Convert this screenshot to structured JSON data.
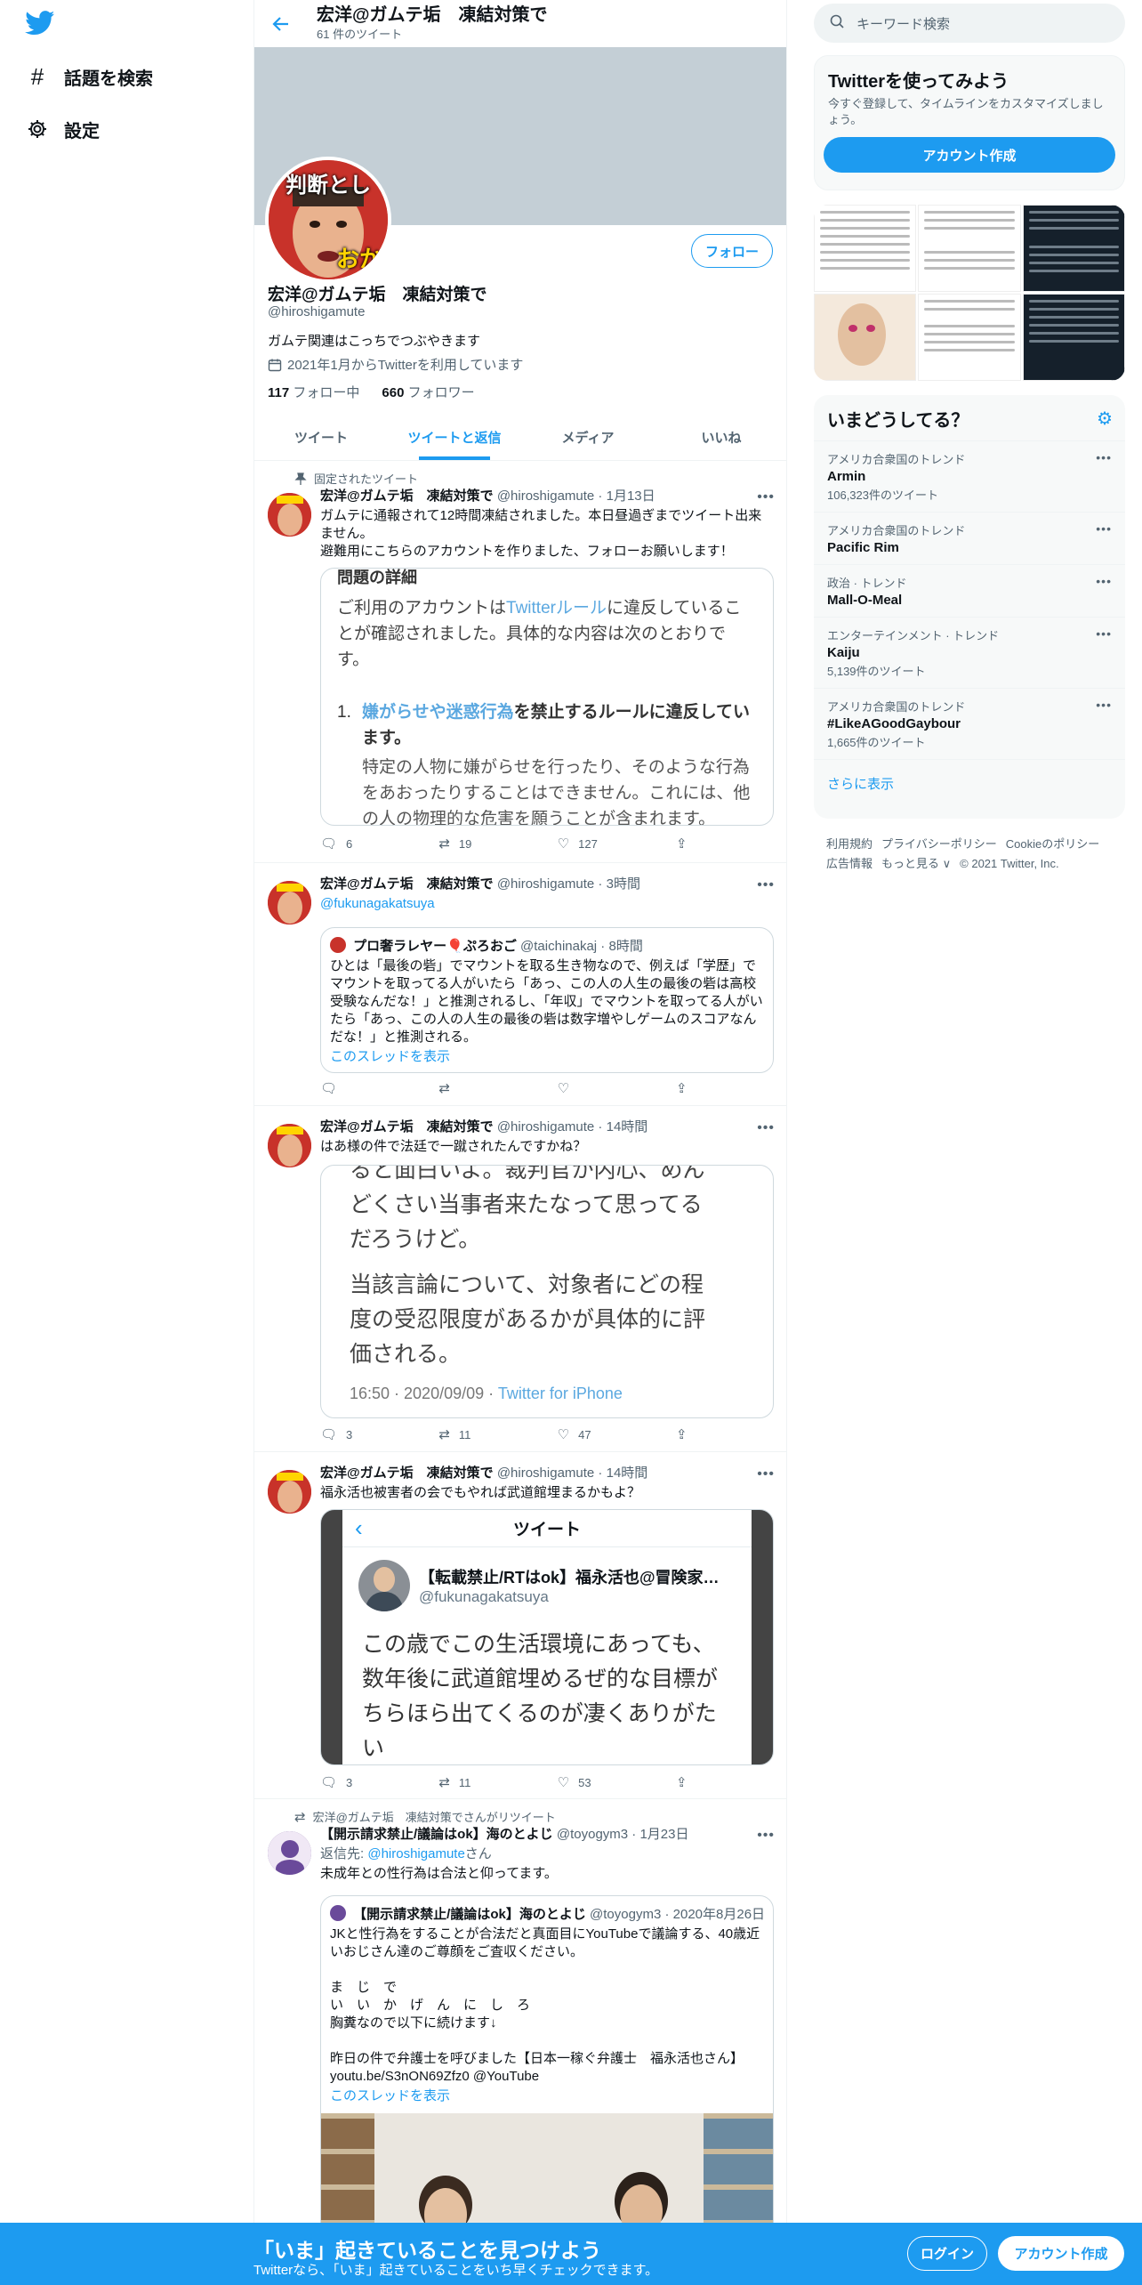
{
  "nav": {
    "explore_label": "話題を検索",
    "settings_label": "設定"
  },
  "header": {
    "title": "宏洋@ガムテ垢　凍結対策で",
    "subtitle": "61 件のツイート"
  },
  "profile": {
    "avatar_text_1": "判断とし",
    "avatar_text_2": "おか",
    "follow_label": "フォロー",
    "name": "宏洋@ガムテ垢　凍結対策で",
    "handle": "@hiroshigamute",
    "bio": "ガムテ関連はこっちでつぶやきます",
    "joined": "2021年1月からTwitterを利用しています",
    "following_count": "117",
    "following_label": "フォロー中",
    "followers_count": "660",
    "followers_label": "フォロワー"
  },
  "tabs": [
    "ツイート",
    "ツイートと返信",
    "メディア",
    "いいね"
  ],
  "tweets": [
    {
      "context": "固定されたツイート",
      "name": "宏洋@ガムテ垢　凍結対策で",
      "handle": "@hiroshigamute",
      "time": "1月13日",
      "text1": "ガムテに通報されて12時間凍結されました。本日昼過ぎまでツイート出来ません。",
      "text2": "避難用にこちらのアカウントを作りました、フォローお願いします！",
      "shot": {
        "heading": "問題の詳細",
        "p1_a": "ご利用のアカウントは",
        "p1_link": "Twitterルール",
        "p1_b": "に違反していることが確認されました。具体的な内容は次のとおりです。",
        "item_num": "1.",
        "item_link": "嫌がらせや迷惑行為",
        "item_b": "を禁止するルールに違反しています。",
        "item_desc": "特定の人物に嫌がらせを行ったり、そのような行為をあおったりすることはできません。これには、他の人の物理的な危害を願うことが含まれます。"
      },
      "replies": "6",
      "retweets": "19",
      "likes": "127"
    },
    {
      "name": "宏洋@ガムテ垢　凍結対策で",
      "handle": "@hiroshigamute",
      "time": "3時間",
      "text1": "@fukunagakatsuya",
      "quote": {
        "name": "プロ奢ラレヤー🎈ぷろおご",
        "handle": "@taichinakaj",
        "time": "8時間",
        "text": "ひとは「最後の砦」でマウントを取る生き物なので、例えば「学歴」でマウントを取ってる人がいたら「あっ、この人の人生の最後の砦は高校受験なんだな！」と推測されるし、「年収」でマウントを取ってる人がいたら「あっ、この人の人生の最後の砦は数字増やしゲームのスコアなんだな！」と推測される。",
        "thread_label": "このスレッドを表示"
      }
    },
    {
      "name": "宏洋@ガムテ垢　凍結対策で",
      "handle": "@hiroshigamute",
      "time": "14時間",
      "text1": "はあ様の件で法廷で一蹴されたんですかね？",
      "shot": {
        "l1": "ると面白いよ。裁判官か内心、めん",
        "l2": "どくさい当事者来たなって思ってる",
        "l3": "だろうけど。",
        "l4": "当該言論について、対象者にどの程",
        "l5": "度の受忍限度があるかが具体的に評",
        "l6": "価される。",
        "meta_time": "16:50 · 2020/09/09 · ",
        "meta_src": "Twitter for iPhone"
      },
      "replies": "3",
      "retweets": "11",
      "likes": "47"
    },
    {
      "name": "宏洋@ガムテ垢　凍結対策で",
      "handle": "@hiroshigamute",
      "time": "14時間",
      "text1": "福永活也被害者の会でもやれば武道館埋まるかもよ？",
      "shot": {
        "title": "ツイート",
        "name": "【転載禁止/RTはok】福永活也@冒険家…",
        "handle": "@fukunagakatsuya",
        "text": "この歳でこの生活環境にあっても、数年後に武道館埋めるぜ的な目標がちらほら出てくるのが凄くありがたい"
      },
      "replies": "3",
      "retweets": "11",
      "likes": "53"
    },
    {
      "context": "宏洋@ガムテ垢　凍結対策でさんがリツイート",
      "name": "【開示請求禁止/議論はok】海のとよじ",
      "handle": "@toyogym3",
      "time": "1月23日",
      "reply_prefix": "返信先: ",
      "reply_to": "@hiroshigamute",
      "reply_suffix": "さん",
      "text1": "未成年との性行為は合法と仰ってます。",
      "quote": {
        "name": "【開示請求禁止/議論はok】海のとよじ",
        "handle": "@toyogym3",
        "time": "2020年8月26日",
        "text1": "JKと性行為をすることが合法だと真面目にYouTubeで議論する、40歳近いおじさん達のご尊顔をご査収ください。",
        "text2": "ま　じ　で",
        "text3": "い　い　か　げ　ん　に　し　ろ",
        "text4": "胸糞なので以下に続けます↓",
        "text5": "昨日の件で弁護士を呼びました【日本一稼ぐ弁護士　福永活也さん】",
        "text6": "youtu.be/S3nON69Zfz0 @YouTube",
        "thread_label": "このスレッドを表示"
      }
    }
  ],
  "right": {
    "search_placeholder": "キーワード検索",
    "signup_title": "Twitterを使ってみよう",
    "signup_desc": "今すぐ登録して、タイムラインをカスタマイズしましょう。",
    "signup_button": "アカウント作成",
    "trends_title": "いまどうしてる？",
    "trends": [
      {
        "category": "アメリカ合衆国のトレンド",
        "name": "Armin",
        "count": "106,323件のツイート"
      },
      {
        "category": "アメリカ合衆国のトレンド",
        "name": "Pacific Rim",
        "count": ""
      },
      {
        "category": "政治 · トレンド",
        "name": "Mall-O-Meal",
        "count": ""
      },
      {
        "category": "エンターテインメント · トレンド",
        "name": "Kaiju",
        "count": "5,139件のツイート"
      },
      {
        "category": "アメリカ合衆国のトレンド",
        "name": "#LikeAGoodGaybour",
        "count": "1,665件のツイート"
      }
    ],
    "show_more": "さらに表示",
    "footer": [
      "利用規約",
      "プライバシーポリシー",
      "Cookieのポリシー",
      "広告情報",
      "もっと見る ∨",
      "© 2021 Twitter, Inc."
    ]
  },
  "bottom_bar": {
    "title": "「いま」起きていることを見つけよう",
    "subtitle": "Twitterなら、「いま」起きていることをいち早くチェックできます。",
    "login": "ログイン",
    "signup": "アカウント作成"
  },
  "colors": {
    "accent": "#1d9bf0",
    "banner": "#c4cfd6",
    "bottom_bar": "#1d9bf0"
  },
  "icons": [
    "twitter-logo-icon",
    "hashtag-icon",
    "gear-icon",
    "back-arrow-icon",
    "calendar-icon",
    "pin-icon",
    "retweet-icon",
    "reply-icon",
    "like-icon",
    "share-icon",
    "search-icon",
    "more-icon"
  ]
}
